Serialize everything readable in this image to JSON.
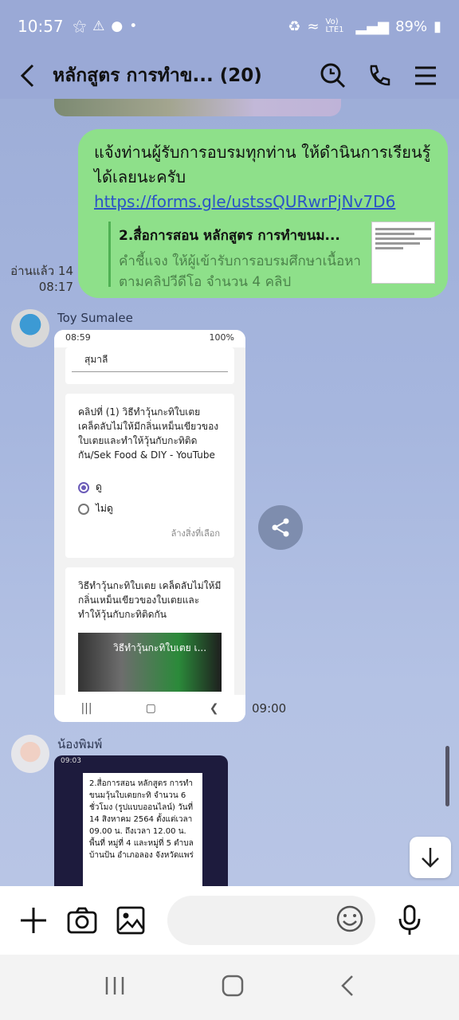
{
  "status_bar": {
    "time": "10:57",
    "network_label": "Vo) LTE1",
    "battery": "89%"
  },
  "header": {
    "title": "หลักสูตร การทำข... (20)"
  },
  "messages": {
    "outgoing": {
      "text": "แจ้งท่านผู้รับการอบรมทุกท่าน  ให้ดำนินการเรียนรู้ได้เลยนะครับ ",
      "link": "https://forms.gle/ustssQURwrPjNv7D6",
      "preview_title": "2.สื่อการสอน หลักสูตร การทำขนม...",
      "preview_desc": "คำชี้แจง ให้ผู้เข้ารับการอบรมศึกษาเนื้อหาตามคลิปวีดีโอ จำนวน 4 คลิป",
      "read_label": "อ่านแล้ว 14",
      "time": "08:17"
    },
    "incoming1": {
      "sender": "Toy  Sumalee",
      "time": "09:00",
      "shot": {
        "status_time": "08:59",
        "status_batt": "100%",
        "name_value": "สุมาลี",
        "question": "คลิปที่ (1) วิธีทำวุ้นกะทิใบเตย เคล็ดลับไม่ให้มีกลิ่นเหม็นเขียวของใบเตยและทำให้วุ้นกับกะทิติดกัน/Sek Food & DIY - YouTube",
        "option_yes": "ดู",
        "option_no": "ไม่ดู",
        "clear_label": "ล้างสิ่งที่เลือก",
        "desc": "วิธีทำวุ้นกะทิใบเตย เคล็ดลับไม่ให้มีกลิ่นเหม็นเขียวของใบเตยและทำให้วุ้นกับกะทิติดกัน",
        "video_title": "วิธีทำวุ้นกะทิใบเตย เ..."
      }
    },
    "incoming2": {
      "sender": "น้องพิมพ์",
      "shot": {
        "status_time": "09:03",
        "paper_text": "2.สื่อการสอน หลักสูตร การทำขนมวุ้นใบเตยกะทิ จำนวน 6 ชั่วโมง (รูปแบบออนไลน์) วันที่ 14 สิงหาคม 2564 ตั้งแต่เวลา 09.00 น. ถึงเวลา 12.00 น. พื้นที่ หมู่ที่ 4 และหมู่ที่ 5 ตำบลบ้านป้น อำเภอลอง จังหวัดแพร่"
      }
    }
  },
  "colors": {
    "chat_bg": "#9aa9d6",
    "outgoing_bubble": "#8ee08a",
    "link": "#2a52c8"
  }
}
